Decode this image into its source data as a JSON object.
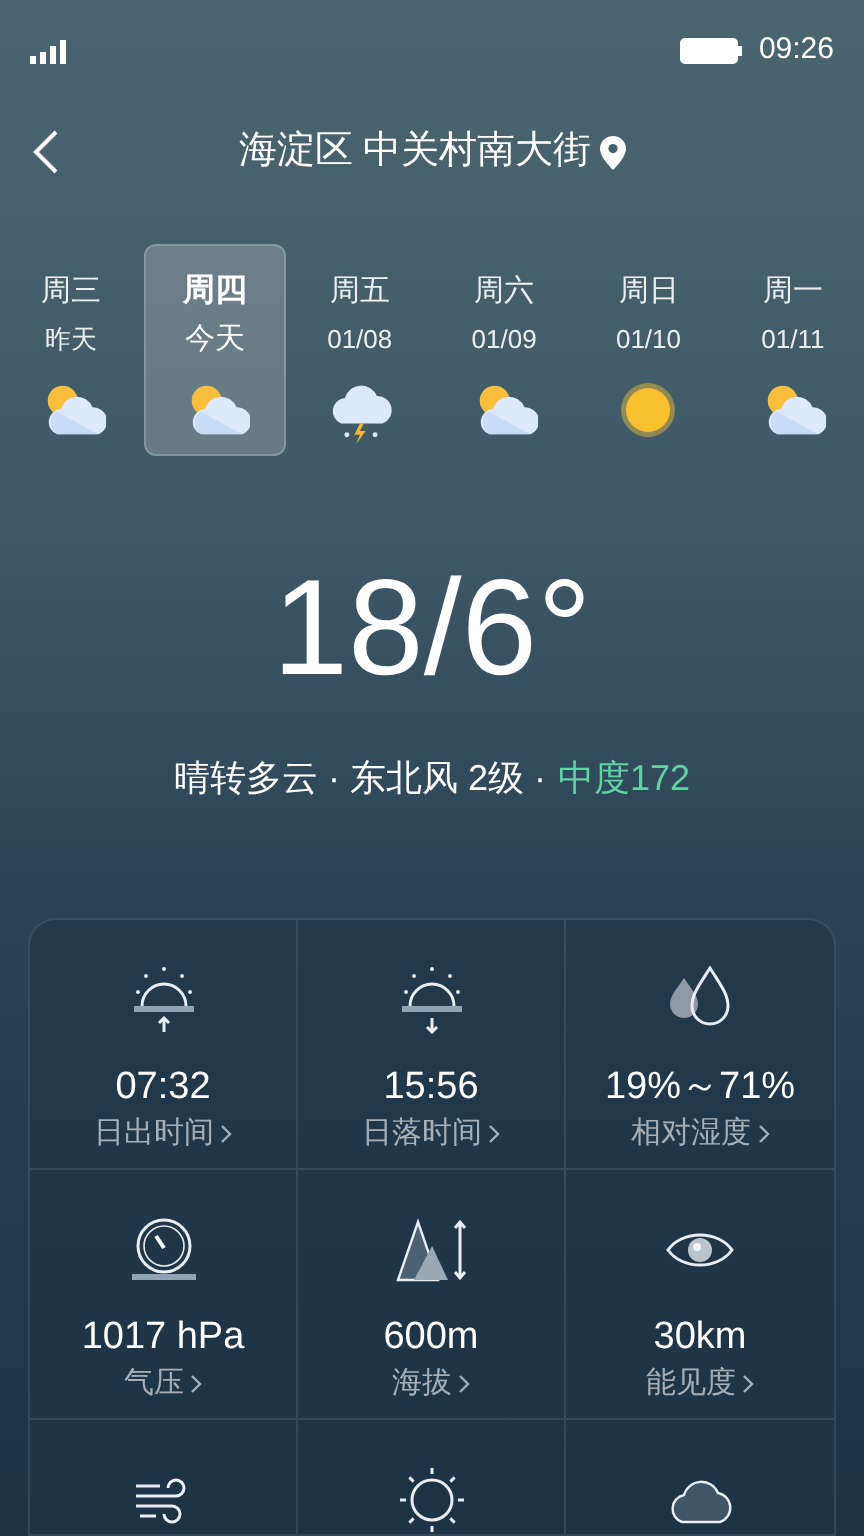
{
  "status_bar": {
    "time": "09:26"
  },
  "header": {
    "location": "海淀区 中关村南大街"
  },
  "days": [
    {
      "weekday": "周三",
      "date": "昨天",
      "kind": "partly-cloudy",
      "selected": false
    },
    {
      "weekday": "周四",
      "date": "今天",
      "kind": "partly-cloudy",
      "selected": true
    },
    {
      "weekday": "周五",
      "date": "01/08",
      "kind": "thunder-rain",
      "selected": false
    },
    {
      "weekday": "周六",
      "date": "01/09",
      "kind": "partly-cloudy",
      "selected": false
    },
    {
      "weekday": "周日",
      "date": "01/10",
      "kind": "sunny",
      "selected": false
    },
    {
      "weekday": "周一",
      "date": "01/11",
      "kind": "partly-cloudy",
      "selected": false
    }
  ],
  "current": {
    "temperature": "18/6°",
    "conditions": "晴转多云 · 东北风 2级 ·",
    "aqi": "中度172"
  },
  "details": [
    {
      "kind": "sunrise",
      "value": "07:32",
      "label": "日出时间"
    },
    {
      "kind": "sunset",
      "value": "15:56",
      "label": "日落时间"
    },
    {
      "kind": "humidity",
      "value": "19%～71%",
      "label": "相对湿度"
    },
    {
      "kind": "pressure",
      "value": "1017 hPa",
      "label": "气压"
    },
    {
      "kind": "altitude",
      "value": "600m",
      "label": "海拔"
    },
    {
      "kind": "visibility",
      "value": "30km",
      "label": "能见度"
    },
    {
      "kind": "wind"
    },
    {
      "kind": "uv"
    },
    {
      "kind": "cloud"
    }
  ]
}
